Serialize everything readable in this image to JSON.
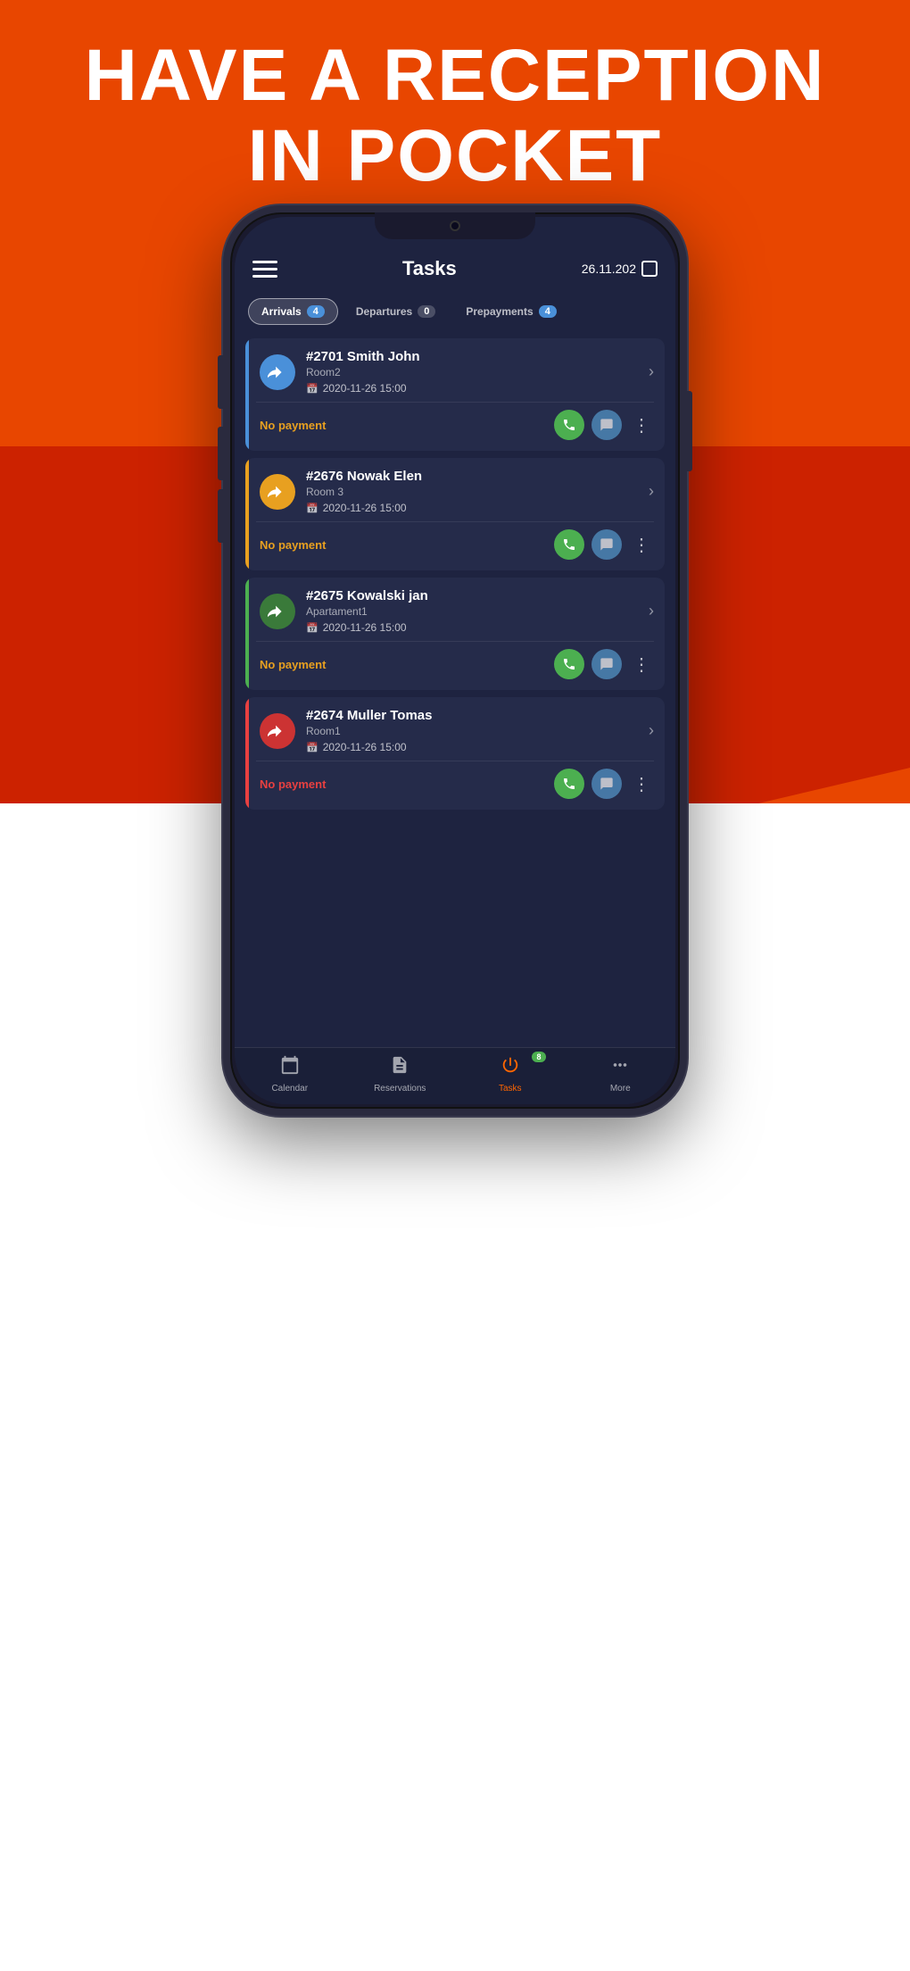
{
  "hero": {
    "line1": "HAVE A RECEPTION",
    "line2": "IN POCKET"
  },
  "app": {
    "header": {
      "title": "Tasks",
      "date": "26.11.202",
      "hamburger_label": "menu"
    },
    "filters": [
      {
        "label": "Arrivals",
        "count": "4",
        "active": true
      },
      {
        "label": "Departures",
        "count": "0",
        "active": false
      },
      {
        "label": "Prepayments",
        "count": "4",
        "active": false
      }
    ],
    "reservations": [
      {
        "id": "#2701",
        "name": "Smith John",
        "room": "Room2",
        "date": "2020-11-26 15:00",
        "payment_status": "No payment",
        "payment_color": "orange",
        "border_color": "blue",
        "icon_color": "blue"
      },
      {
        "id": "#2676",
        "name": "Nowak Elen",
        "room": "Room 3",
        "date": "2020-11-26 15:00",
        "payment_status": "No payment",
        "payment_color": "orange",
        "border_color": "orange",
        "icon_color": "orange"
      },
      {
        "id": "#2675",
        "name": "Kowalski jan",
        "room": "Apartament1",
        "date": "2020-11-26 15:00",
        "payment_status": "No payment",
        "payment_color": "orange",
        "border_color": "green",
        "icon_color": "green"
      },
      {
        "id": "#2674",
        "name": "Muller Tomas",
        "room": "Room1",
        "date": "2020-11-26 15:00",
        "payment_status": "No payment",
        "payment_color": "red",
        "border_color": "red",
        "icon_color": "red"
      }
    ],
    "bottom_nav": [
      {
        "label": "Calendar",
        "icon": "📅",
        "active": false
      },
      {
        "label": "Reservations",
        "icon": "📋",
        "active": false
      },
      {
        "label": "Tasks",
        "icon": "⚡",
        "active": true,
        "badge": "8"
      },
      {
        "label": "More",
        "icon": "···",
        "active": false
      }
    ]
  }
}
